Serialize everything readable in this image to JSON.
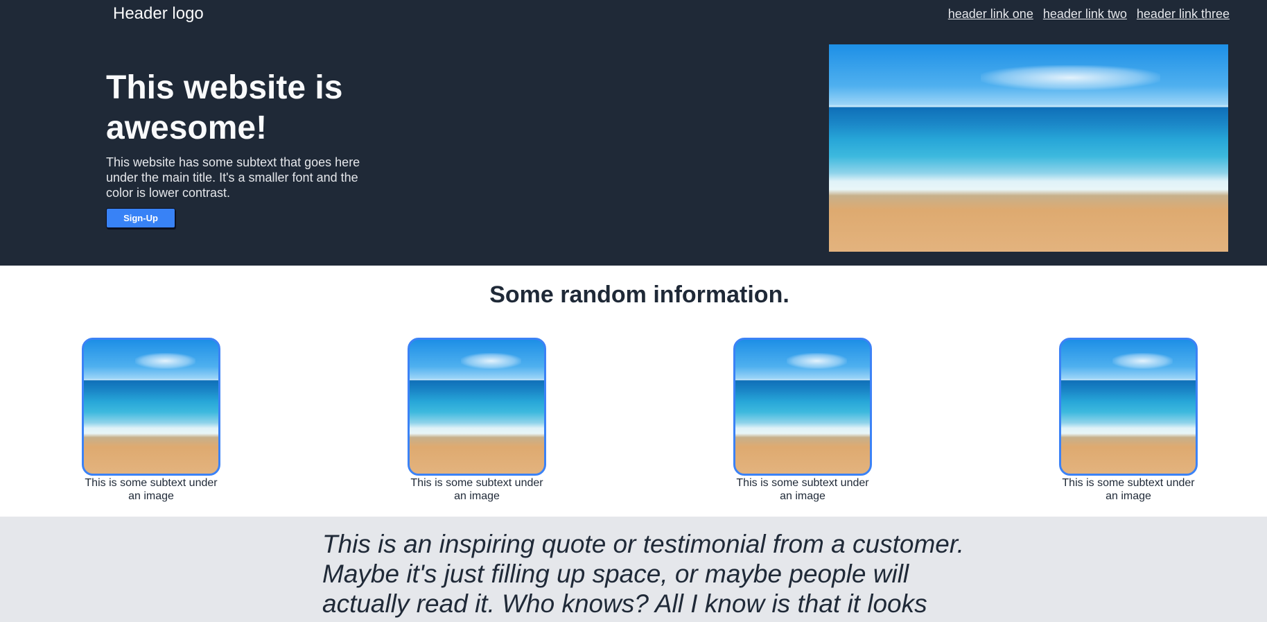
{
  "header": {
    "logo": "Header logo",
    "links": [
      "header link one",
      "header link two",
      "header link three"
    ]
  },
  "hero": {
    "title": "This website is awesome!",
    "subtext": "This website has some subtext that goes here under the main title. It's a smaller font and the color is lower contrast.",
    "button_label": "Sign-Up",
    "image_icon": "beach-image"
  },
  "info": {
    "title": "Some random information.",
    "cards": [
      {
        "text": "This is some subtext under an image"
      },
      {
        "text": "This is some subtext under an image"
      },
      {
        "text": "This is some subtext under an image"
      },
      {
        "text": "This is some subtext under an image"
      }
    ]
  },
  "quote": {
    "text": "This is an inspiring quote or testimonial from a customer. Maybe it's just filling up space, or maybe people will actually read it. Who knows? All I know is that it looks"
  },
  "colors": {
    "header_bg": "#1f2937",
    "accent": "#3882f6",
    "quote_bg": "#e5e7eb"
  }
}
